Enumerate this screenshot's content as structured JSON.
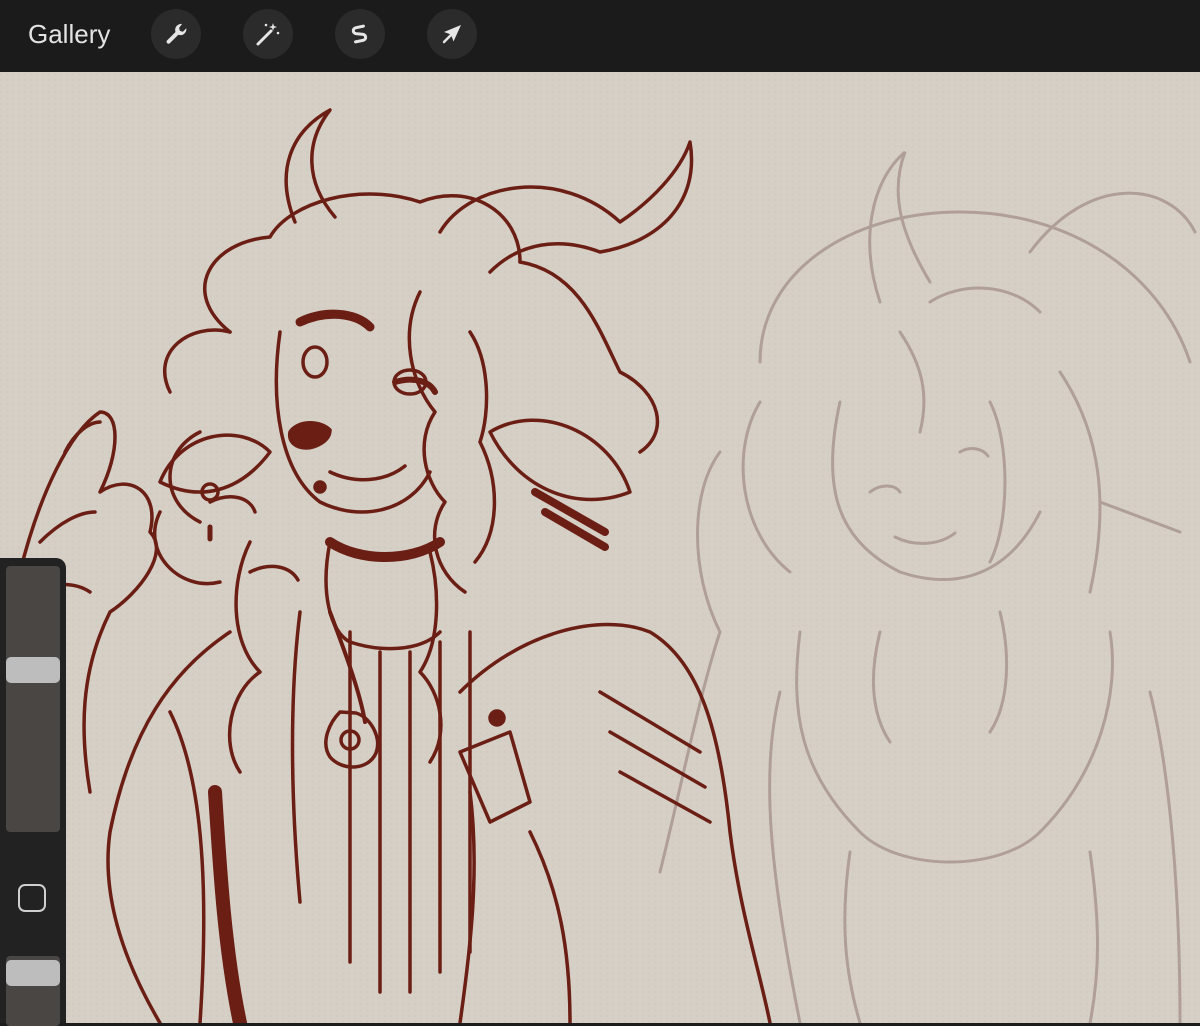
{
  "topbar": {
    "gallery_label": "Gallery",
    "tools": [
      {
        "name": "actions",
        "icon": "wrench-icon"
      },
      {
        "name": "adjustments",
        "icon": "magic-wand-icon"
      },
      {
        "name": "selection",
        "icon": "selection-s-icon"
      },
      {
        "name": "transform",
        "icon": "arrow-cursor-icon"
      }
    ]
  },
  "sidebar": {
    "brush_size_level": 0.62,
    "opacity_level": 0.9,
    "modify_button_icon": "square-icon"
  },
  "colors": {
    "toolbar_bg": "#1b1b1b",
    "canvas_bg": "#d6cfc6",
    "primary_line": "#6b1e14",
    "ghost_line": "#a08c84"
  }
}
